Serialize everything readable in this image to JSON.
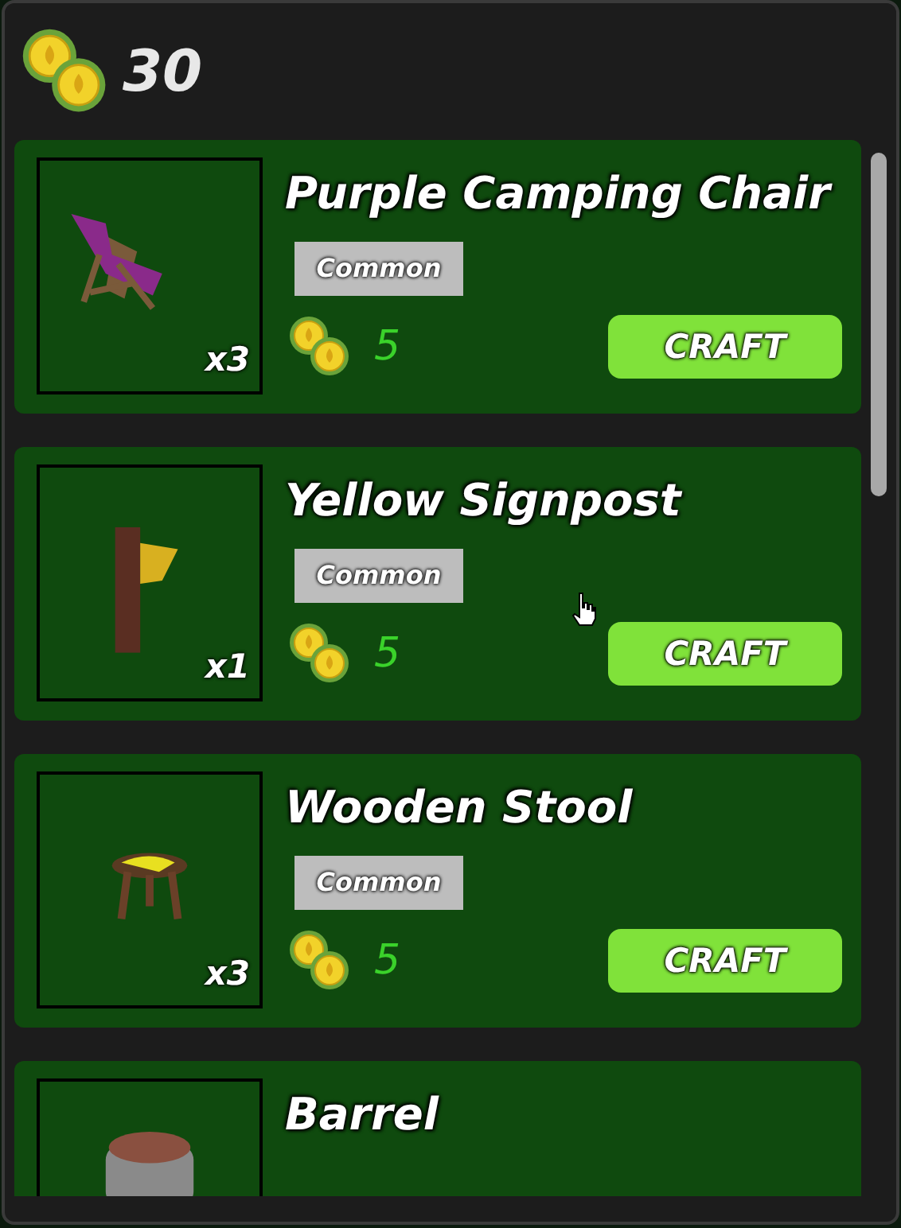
{
  "currency": {
    "amount": "30"
  },
  "items": [
    {
      "kind": "chair",
      "name": "Purple Camping Chair",
      "rarity": "Common",
      "quantity": "x3",
      "cost": "5",
      "button": "CRAFT"
    },
    {
      "kind": "signpost",
      "name": "Yellow Signpost",
      "rarity": "Common",
      "quantity": "x1",
      "cost": "5",
      "button": "CRAFT"
    },
    {
      "kind": "stool",
      "name": "Wooden Stool",
      "rarity": "Common",
      "quantity": "x3",
      "cost": "5",
      "button": "CRAFT"
    },
    {
      "kind": "barrel",
      "name": "Barrel"
    }
  ]
}
